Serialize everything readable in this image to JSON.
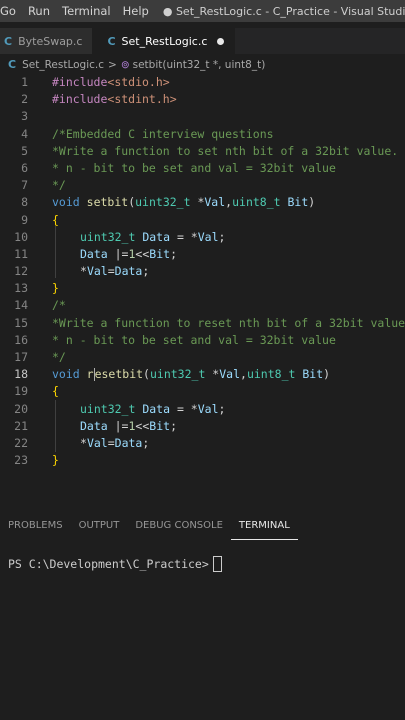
{
  "menubar": {
    "items": [
      "Go",
      "Run",
      "Terminal",
      "Help"
    ],
    "window_title": "● Set_RestLogic.c - C_Practice - Visual Studio Code"
  },
  "tabs": [
    {
      "icon": "C",
      "label": "ByteSwap.c",
      "active": false
    },
    {
      "icon": "C",
      "label": "Set_RestLogic.c",
      "active": true
    }
  ],
  "breadcrumb": {
    "file": "Set_RestLogic.c",
    "separator": ">",
    "symbol": "setbit(uint32_t *, uint8_t)"
  },
  "editor": {
    "line_numbers": [
      "1",
      "2",
      "3",
      "4",
      "5",
      "6",
      "7",
      "8",
      "9",
      "10",
      "11",
      "12",
      "13",
      "14",
      "15",
      "16",
      "17",
      "18",
      "19",
      "20",
      "21",
      "22",
      "23"
    ],
    "current_line": "18",
    "lines": {
      "l1": [
        "#include",
        "<stdio.h>"
      ],
      "l2": [
        "#include",
        "<stdint.h>"
      ],
      "l4": "/*Embedded C interview questions",
      "l5": "*Write a function to set nth bit of a 32bit value.",
      "l6": "* n - bit to be set and val = 32bit value",
      "l7": "*/",
      "l8": [
        "void",
        " ",
        "setbit",
        "(",
        "uint32_t",
        " *",
        "Val",
        ",",
        "uint8_t",
        " ",
        "Bit",
        ")"
      ],
      "l9": "{",
      "l10": [
        "uint32_t",
        " ",
        "Data",
        " = *",
        "Val",
        ";"
      ],
      "l11": [
        "Data",
        " |=",
        "1",
        "<<",
        "Bit",
        ";"
      ],
      "l12": [
        "*",
        "Val",
        "=",
        "Data",
        ";"
      ],
      "l13": "}",
      "l14": "/*",
      "l15": "*Write a function to reset nth bit of a 32bit value",
      "l16": "* n - bit to be set and val = 32bit value",
      "l17": "*/",
      "l18": [
        "void",
        " ",
        "r",
        "esetbit",
        "(",
        "uint32_t",
        " *",
        "Val",
        ",",
        "uint8_t",
        " ",
        "Bit",
        ")"
      ],
      "l19": "{",
      "l20": [
        "uint32_t",
        " ",
        "Data",
        " = *",
        "Val",
        ";"
      ],
      "l21": [
        "Data",
        " |=",
        "1",
        "<<",
        "Bit",
        ";"
      ],
      "l22": [
        "*",
        "Val",
        "=",
        "Data",
        ";"
      ],
      "l23": "}"
    }
  },
  "panel": {
    "tabs": [
      "PROBLEMS",
      "OUTPUT",
      "DEBUG CONSOLE",
      "TERMINAL"
    ],
    "active_tab": "TERMINAL",
    "prompt": "PS C:\\Development\\C_Practice>"
  },
  "colors": {
    "background": "#1e1e1e",
    "comment": "#6a9955",
    "keyword": "#569cd6",
    "function": "#dcdcaa",
    "type": "#4ec9b0",
    "variable": "#9cdcfe",
    "preprocessor": "#c586c0",
    "string": "#ce9178"
  }
}
